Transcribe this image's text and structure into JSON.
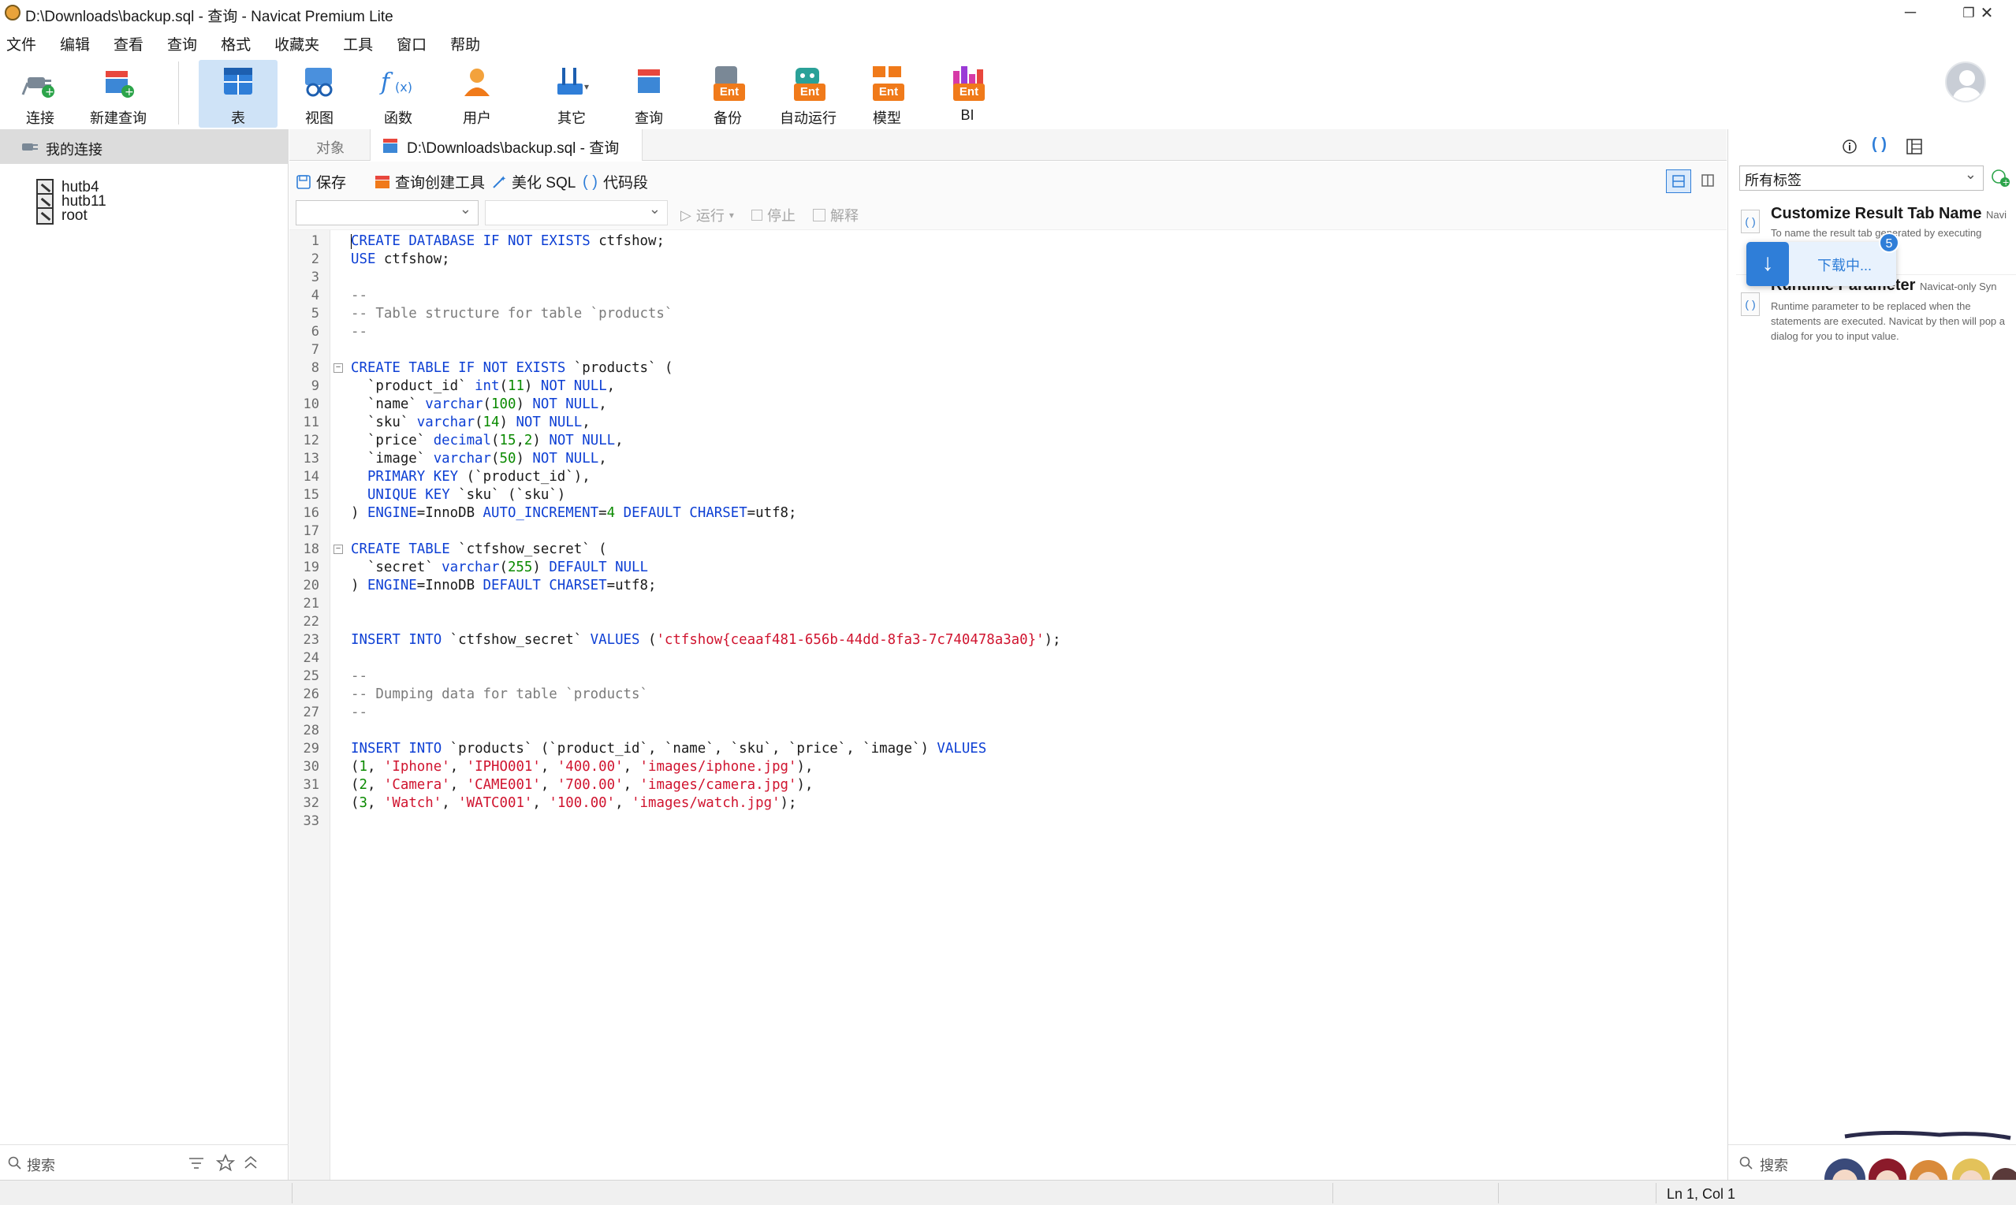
{
  "window": {
    "title": "D:\\Downloads\\backup.sql - 查询 - Navicat Premium Lite",
    "controls": [
      "─",
      "❐",
      "✕"
    ]
  },
  "menu": [
    "文件",
    "编辑",
    "查看",
    "查询",
    "格式",
    "收藏夹",
    "工具",
    "窗口",
    "帮助"
  ],
  "toolbar": {
    "buttons": [
      {
        "label": "连接",
        "icon": "connect-plug-icon"
      },
      {
        "label": "新建查询",
        "icon": "new-query-icon"
      },
      {
        "label": "表",
        "icon": "table-icon",
        "active": true
      },
      {
        "label": "视图",
        "icon": "view-icon"
      },
      {
        "label": "函数",
        "icon": "function-icon",
        "glyph": "f(x)"
      },
      {
        "label": "用户",
        "icon": "user-icon"
      },
      {
        "label": "其它",
        "icon": "tools-icon"
      },
      {
        "label": "查询",
        "icon": "query-icon"
      },
      {
        "label": "备份",
        "icon": "backup-icon",
        "badge": "Ent"
      },
      {
        "label": "自动运行",
        "icon": "automation-icon",
        "badge": "Ent"
      },
      {
        "label": "模型",
        "icon": "model-icon",
        "badge": "Ent"
      },
      {
        "label": "BI",
        "icon": "bi-icon",
        "badge": "Ent"
      }
    ]
  },
  "sidebar": {
    "header": "我的连接",
    "connections": [
      "hutb4",
      "hutb11",
      "root"
    ],
    "search_placeholder": "搜索"
  },
  "tabs": {
    "objects": "对象",
    "query": "D:\\Downloads\\backup.sql - 查询"
  },
  "query_toolbar": {
    "save": "保存",
    "builder": "查询创建工具",
    "beautify": "美化 SQL",
    "snippet": "代码段"
  },
  "run_bar": {
    "run": "运行",
    "stop": "停止",
    "explain": "解释"
  },
  "editor": {
    "lines": [
      "CREATE DATABASE IF NOT EXISTS ctfshow;",
      "USE ctfshow;",
      "",
      "--",
      "-- Table structure for table `products`",
      "--",
      "",
      "CREATE TABLE IF NOT EXISTS `products` (",
      "  `product_id` int(11) NOT NULL,",
      "  `name` varchar(100) NOT NULL,",
      "  `sku` varchar(14) NOT NULL,",
      "  `price` decimal(15,2) NOT NULL,",
      "  `image` varchar(50) NOT NULL,",
      "  PRIMARY KEY (`product_id`),",
      "  UNIQUE KEY `sku` (`sku`)",
      ") ENGINE=InnoDB AUTO_INCREMENT=4 DEFAULT CHARSET=utf8;",
      "",
      "CREATE TABLE `ctfshow_secret` (",
      "  `secret` varchar(255) DEFAULT NULL",
      ") ENGINE=InnoDB DEFAULT CHARSET=utf8;",
      "",
      "",
      "INSERT INTO `ctfshow_secret` VALUES ('ctfshow{ceaaf481-656b-44dd-8fa3-7c740478a3a0}');",
      "",
      "--",
      "-- Dumping data for table `products`",
      "--",
      "",
      "INSERT INTO `products` (`product_id`, `name`, `sku`, `price`, `image`) VALUES",
      "(1, 'Iphone', 'IPHO001', '400.00', 'images/iphone.jpg'),",
      "(2, 'Camera', 'CAME001', '700.00', 'images/camera.jpg'),",
      "(3, 'Watch', 'WATC001', '100.00', 'images/watch.jpg');",
      ""
    ],
    "fold_lines": [
      8,
      18
    ]
  },
  "right_panel": {
    "filter": "所有标签",
    "snippets": [
      {
        "title": "Customize Result Tab Name",
        "suffix": "Navi",
        "desc": "To name the result tab generated by executing"
      },
      {
        "title": "Runtime Parameter",
        "suffix": "Navicat-only Syn",
        "desc": "Runtime parameter to be replaced when the statements are executed. Navicat by then will pop a dialog for you to input value."
      }
    ],
    "download_popup": {
      "text": "下载中...",
      "badge": "5"
    },
    "search_placeholder": "搜索"
  },
  "status": {
    "position": "Ln 1, Col 1"
  },
  "colors": {
    "keyword": "#0d3fd4",
    "string": "#d0142f",
    "number": "#0a8a00",
    "comment": "#7b7b7b",
    "active_tool": "#cfe3f7",
    "ent_badge": "#f07a1a"
  }
}
